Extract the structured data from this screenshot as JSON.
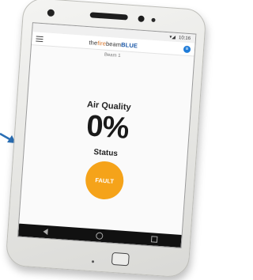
{
  "status_bar": {
    "time": "10:16",
    "signal": "▾◢"
  },
  "app_bar": {
    "brand_part1": "the",
    "brand_part2": "fire",
    "brand_part3": "beam",
    "brand_part4": "BLUE",
    "bluetooth_glyph": "ʙ"
  },
  "subtitle": "Beam 1",
  "air_quality": {
    "label": "Air Quality",
    "value": "0%"
  },
  "status": {
    "label": "Status",
    "button_label": "FAULT",
    "button_color": "#f5a31a"
  },
  "icons": [
    "arrow-icon",
    "menu-icon",
    "bluetooth-icon",
    "back-icon",
    "home-icon",
    "recents-icon"
  ]
}
